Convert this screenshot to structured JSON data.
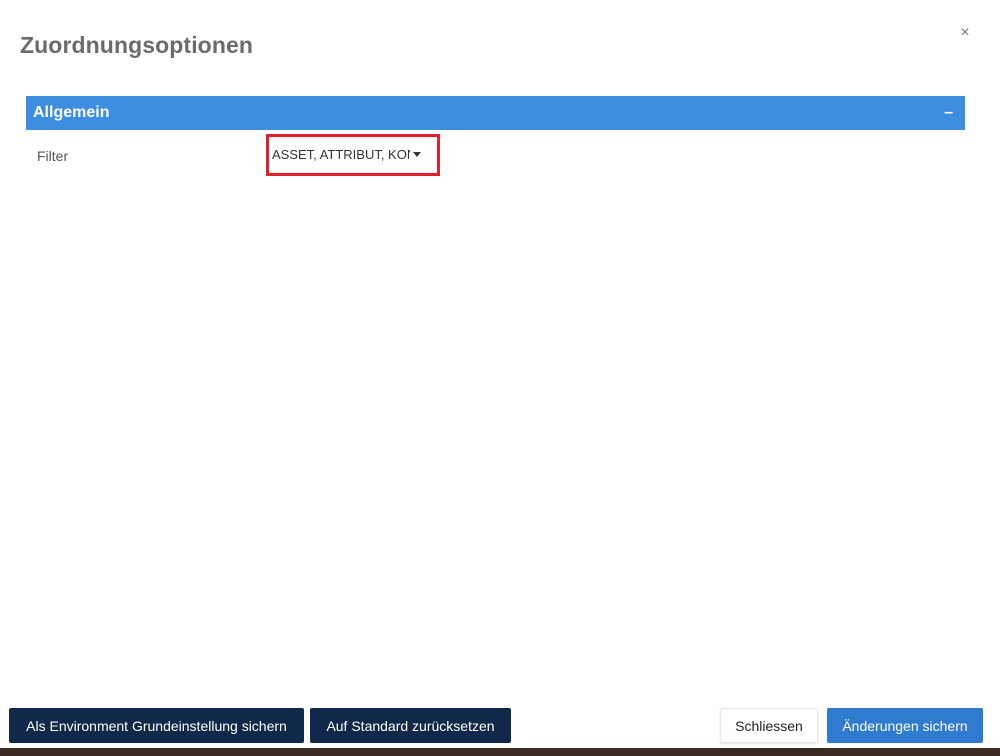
{
  "dialog": {
    "title": "Zuordnungsoptionen",
    "close_symbol": "×"
  },
  "section": {
    "title": "Allgemein",
    "collapse_symbol": "–"
  },
  "filter": {
    "label": "Filter",
    "value": "ASSET, ATTRIBUT, KON",
    "highlight_color": "#e0202b"
  },
  "footer": {
    "save_environment_default_label": "Als Environment Grundeinstellung sichern",
    "reset_to_default_label": "Auf Standard zurücksetzen",
    "close_label": "Schliessen",
    "save_changes_label": "Änderungen sichern"
  },
  "colors": {
    "section_header": "#3d8ee1",
    "dark_button": "#10294a",
    "primary_button": "#2e7bd0"
  }
}
